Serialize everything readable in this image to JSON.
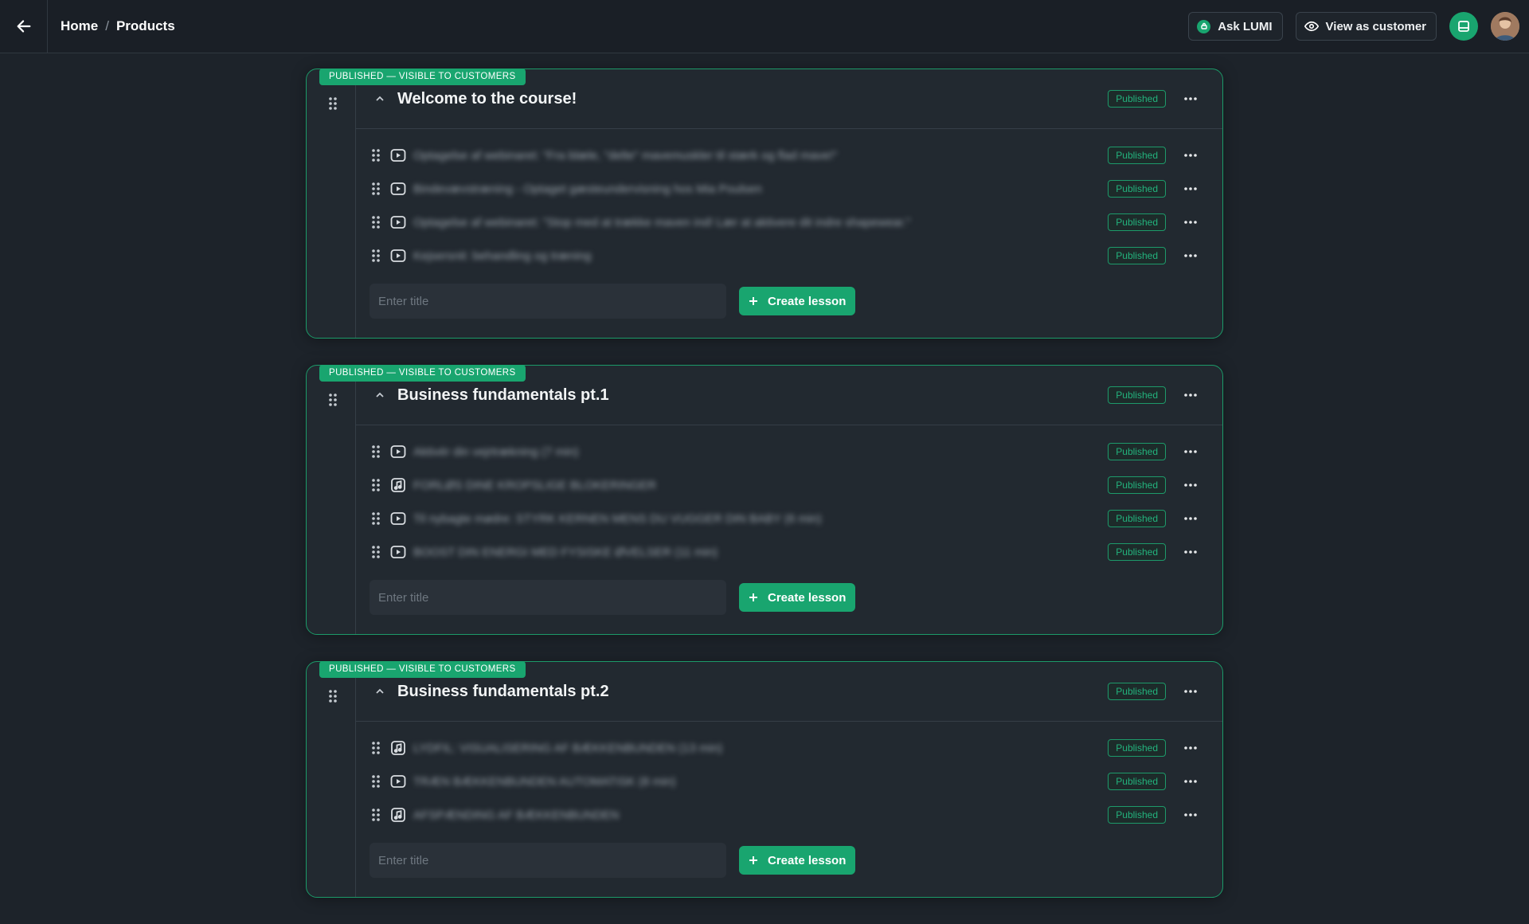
{
  "header": {
    "breadcrumb": [
      "Home",
      "Products"
    ],
    "breadcrumb_separator": "/",
    "ask_label": "Ask LUMI",
    "view_label": "View as customer"
  },
  "colors": {
    "accent": "#19a56f",
    "background": "#1d232a",
    "card": "#222930"
  },
  "sections": [
    {
      "tag": "PUBLISHED — VISIBLE TO CUSTOMERS",
      "title": "Welcome to the course!",
      "status": "Published",
      "lessons": [
        {
          "icon": "video-icon",
          "title": "Optagelse af webinaret: \"Fra blæle, \"delte\" mavemuskler til stærk og flad mave!\"",
          "status": "Published"
        },
        {
          "icon": "video-icon",
          "title": "Bindevævstræning - Optaget gæsteundervisning hos Mia Poulsen",
          "status": "Published"
        },
        {
          "icon": "video-icon",
          "title": "Optagelse af webinaret: \"Stop med at trække maven ind! Lær at aktivere dit indre shapewear.\"",
          "status": "Published"
        },
        {
          "icon": "video-icon",
          "title": "Kejsersnit: behandling og træning",
          "status": "Published"
        }
      ],
      "input_placeholder": "Enter title",
      "create_label": "Create lesson"
    },
    {
      "tag": "PUBLISHED — VISIBLE TO CUSTOMERS",
      "title": "Business fundamentals pt.1",
      "status": "Published",
      "lessons": [
        {
          "icon": "video-icon",
          "title": "Aktivér din vejrtrækning (7 min)",
          "status": "Published"
        },
        {
          "icon": "audio-icon",
          "title": "FORLØS DINE KROPSLIGE BLOKERINGER",
          "status": "Published"
        },
        {
          "icon": "video-icon",
          "title": "Til nybagte mødre: STYRK KERNEN MENS DU VUGGER DIN BABY (6 min)",
          "status": "Published"
        },
        {
          "icon": "video-icon",
          "title": "BOOST DIN ENERGI MED FYSISKE ØVELSER (11 min)",
          "status": "Published"
        }
      ],
      "input_placeholder": "Enter title",
      "create_label": "Create lesson"
    },
    {
      "tag": "PUBLISHED — VISIBLE TO CUSTOMERS",
      "title": "Business fundamentals pt.2",
      "status": "Published",
      "lessons": [
        {
          "icon": "audio-icon",
          "title": "LYDFIL: VISUALISERING AF BÆKKENBUNDEN (13 min)",
          "status": "Published"
        },
        {
          "icon": "video-icon",
          "title": "TRÆN BÆKKENBUNDEN AUTOMATISK (8 min)",
          "status": "Published"
        },
        {
          "icon": "audio-icon",
          "title": "AFSPÆNDING AF BÆKKENBUNDEN",
          "status": "Published"
        }
      ],
      "input_placeholder": "Enter title",
      "create_label": "Create lesson"
    }
  ]
}
